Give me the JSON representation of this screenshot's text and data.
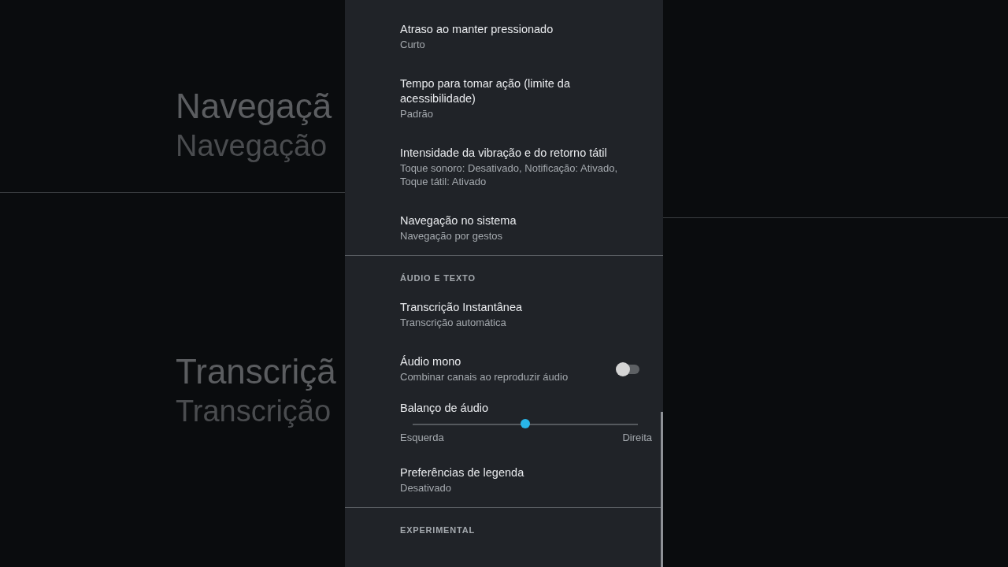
{
  "backdrop": {
    "texts": [
      {
        "kind": "title",
        "text": "Navegaçã"
      },
      {
        "kind": "summary",
        "text": "Navegação"
      },
      {
        "kind": "divider"
      },
      {
        "kind": "title",
        "text": "Transcriçã"
      },
      {
        "kind": "summary",
        "text": "Transcrição"
      }
    ]
  },
  "settings": {
    "sections": [
      {
        "items": [
          {
            "kind": "text",
            "title": "Atraso ao manter pressionado",
            "summary": "Curto"
          },
          {
            "kind": "text",
            "title": "Tempo para tomar ação (limite da acessibilidade)",
            "summary": "Padrão"
          },
          {
            "kind": "text",
            "title": "Intensidade da vibração e do retorno tátil",
            "summary": "Toque sonoro: Desativado, Notificação: Ativado, Toque tátil: Ativado"
          },
          {
            "kind": "text",
            "title": "Navegação no sistema",
            "summary": "Navegação por gestos"
          }
        ]
      },
      {
        "header": "ÁUDIO E TEXTO",
        "items": [
          {
            "kind": "text",
            "title": "Transcrição Instantânea",
            "summary": "Transcrição automática"
          },
          {
            "kind": "switch",
            "title": "Áudio mono",
            "summary": "Combinar canais ao reproduzir áudio",
            "on": false
          },
          {
            "kind": "slider",
            "title": "Balanço de áudio",
            "level": 0.5,
            "left_label": "Esquerda",
            "right_label": "Direita"
          },
          {
            "kind": "text",
            "title": "Preferências de legenda",
            "summary": "Desativado"
          }
        ]
      },
      {
        "header": "EXPERIMENTAL"
      }
    ]
  }
}
